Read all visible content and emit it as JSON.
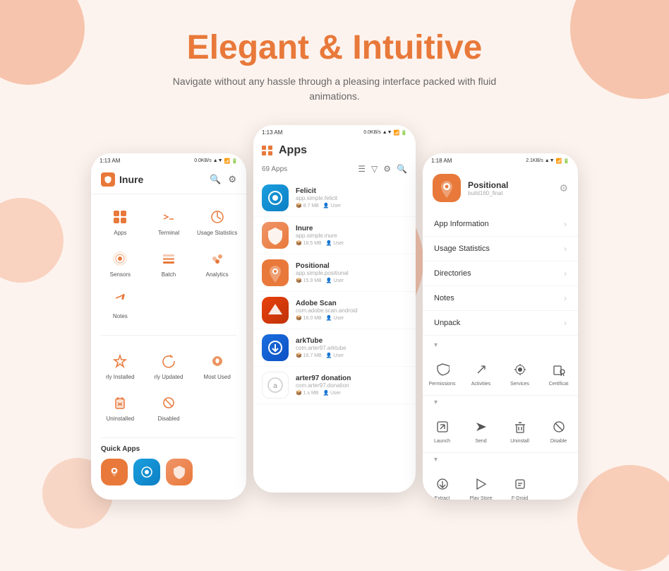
{
  "page": {
    "title": "Elegant & Intuitive",
    "subtitle": "Navigate without any hassle through a pleasing interface packed with fluid animations."
  },
  "phone_left": {
    "status": {
      "time": "1:13 AM",
      "network": "0.0KB/s",
      "signal": "▲▼",
      "battery": "🔋"
    },
    "header": {
      "app_name": "Inure"
    },
    "menu_items": [
      {
        "label": "Apps",
        "icon": "apps"
      },
      {
        "label": "Terminal",
        "icon": "terminal"
      },
      {
        "label": "Usage Statistics",
        "icon": "usage"
      },
      {
        "label": "Sensors",
        "icon": "sensors"
      },
      {
        "label": "Batch",
        "icon": "batch"
      },
      {
        "label": "Analytics",
        "icon": "analytics"
      },
      {
        "label": "Notes",
        "icon": "notes"
      }
    ],
    "second_section": [
      {
        "label": "rly Installed",
        "icon": "installed"
      },
      {
        "label": "rly Updated",
        "icon": "updated"
      },
      {
        "label": "Most Used",
        "icon": "most-used"
      },
      {
        "label": "Uninstalled",
        "icon": "uninstalled"
      },
      {
        "label": "Disabled",
        "icon": "disabled"
      }
    ],
    "quick_apps_label": "Quick Apps"
  },
  "phone_center": {
    "status": {
      "time": "1:13 AM",
      "network": "0.0KB/s"
    },
    "header": {
      "title": "Apps"
    },
    "count": "69 Apps",
    "apps": [
      {
        "name": "Felicit",
        "pkg": "app.simple.felicit",
        "size": "8.7 MB",
        "type": "User"
      },
      {
        "name": "Inure",
        "pkg": "app.simple.inure",
        "size": "18.5 MB",
        "type": "User"
      },
      {
        "name": "Positional",
        "pkg": "app.simple.positional",
        "size": "15.9 MB",
        "type": "User"
      },
      {
        "name": "Adobe Scan",
        "pkg": "com.adobe.scan.android",
        "size": "16.0 MB",
        "type": "User"
      },
      {
        "name": "arkTube",
        "pkg": "com.arter97.arktube",
        "size": "16.7 MB",
        "type": "User"
      },
      {
        "name": "arter97 donation",
        "pkg": "com.arter97.donation",
        "size": "1.x MB",
        "type": "User"
      }
    ]
  },
  "phone_right": {
    "status": {
      "time": "1:18 AM",
      "network": "2.1KB/s"
    },
    "app": {
      "name": "Positional",
      "pkg": "build160_final"
    },
    "menu": [
      {
        "label": "App Information"
      },
      {
        "label": "Usage Statistics"
      },
      {
        "label": "Directories"
      },
      {
        "label": "Notes"
      },
      {
        "label": "Unpack"
      }
    ],
    "actions_1": [
      {
        "label": "Permissions",
        "icon": "shield"
      },
      {
        "label": "Activities",
        "icon": "activities"
      },
      {
        "label": "Services",
        "icon": "services"
      },
      {
        "label": "Certificat",
        "icon": "certificate"
      }
    ],
    "actions_2": [
      {
        "label": "Launch",
        "icon": "launch"
      },
      {
        "label": "Send",
        "icon": "send"
      },
      {
        "label": "Uninstall",
        "icon": "uninstall"
      },
      {
        "label": "Disable",
        "icon": "disable"
      }
    ],
    "actions_3": [
      {
        "label": "Extract",
        "icon": "extract"
      },
      {
        "label": "Play Store",
        "icon": "playstore"
      },
      {
        "label": "F-Droid",
        "icon": "fdroid"
      }
    ]
  }
}
